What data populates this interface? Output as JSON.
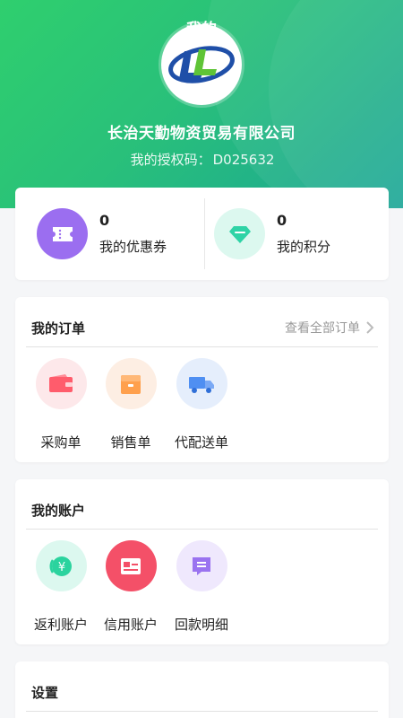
{
  "header": {
    "title": "我的",
    "company_name": "长治天勤物资贸易有限公司",
    "auth_label": "我的授权码：",
    "auth_code": "D025632",
    "logo_alt": "LL"
  },
  "stats": [
    {
      "value": "0",
      "label": "我的优惠券",
      "icon": "coupon-icon"
    },
    {
      "value": "0",
      "label": "我的积分",
      "icon": "diamond-icon"
    }
  ],
  "orders": {
    "title": "我的订单",
    "view_all": "查看全部订单",
    "items": [
      {
        "label": "采购单",
        "icon": "wallet-icon"
      },
      {
        "label": "销售单",
        "icon": "box-icon"
      },
      {
        "label": "代配送单",
        "icon": "truck-icon"
      }
    ]
  },
  "accounts": {
    "title": "我的账户",
    "items": [
      {
        "label": "返利账户",
        "icon": "rebate-icon"
      },
      {
        "label": "信用账户",
        "icon": "credit-card-icon"
      },
      {
        "label": "回款明细",
        "icon": "message-list-icon"
      }
    ]
  },
  "settings": {
    "title": "设置"
  },
  "colors": {
    "header_start": "#2fcf6e",
    "header_end": "#1aa596",
    "coupon": "#9b6ef0",
    "diamond": "#2fd3a6",
    "wallet": "#ff5c6c",
    "box": "#ffa04d",
    "truck": "#4f8ff2",
    "rebate": "#2bd39e",
    "credit": "#f45068",
    "detail": "#9a73f0"
  }
}
